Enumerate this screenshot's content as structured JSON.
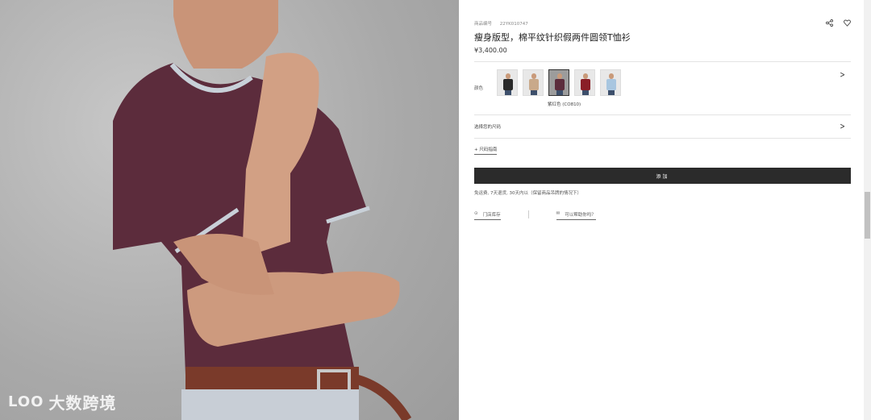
{
  "watermark": {
    "logo": "LOO",
    "text": "大数跨境"
  },
  "product": {
    "meta_label": "商品编号",
    "meta_code": "22YK010747",
    "title": "瘦身版型，棉平纹针织假两件圆领T恤衫",
    "price": "¥3,400.00"
  },
  "actions": {
    "share_icon": "share-icon",
    "wishlist_icon": "heart-icon"
  },
  "color": {
    "label": "颜色",
    "selected_name": "紫红色 (CO810)",
    "swatches": [
      {
        "shirt": "#2a2a2a"
      },
      {
        "shirt": "#c9a98a"
      },
      {
        "shirt": "#5c2c3c",
        "selected": true
      },
      {
        "shirt": "#8a1f27"
      },
      {
        "shirt": "#a8c6e0"
      }
    ]
  },
  "size": {
    "label": "选择您的尺码"
  },
  "size_guide": {
    "label": "+ 尺码指南"
  },
  "cart": {
    "add_label": "添加"
  },
  "shipping": {
    "text": "免运费, 7天退货, 30天内以（保留商品吊牌的情况下）"
  },
  "store": {
    "find_label": "门店库存",
    "help_label": "可以帮助你吗？"
  },
  "colors": {
    "button_bg": "#2b2b2b",
    "shirt": "#5c2c3c"
  }
}
